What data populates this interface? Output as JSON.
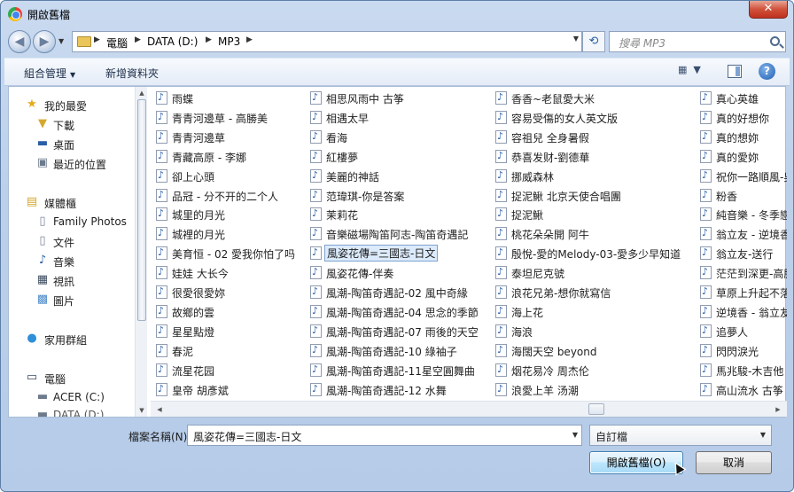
{
  "window": {
    "title": "開啟舊檔",
    "close_label": "✕"
  },
  "nav": {
    "breadcrumbs": [
      "電腦",
      "DATA (D:)",
      "MP3"
    ],
    "search_placeholder": "搜尋 MP3"
  },
  "toolbar": {
    "organize": "組合管理",
    "new_folder": "新增資料夾"
  },
  "sidebar": {
    "items": [
      {
        "label": "我的最愛",
        "icon": "star-icon"
      },
      {
        "label": "下載",
        "icon": "download-folder-icon"
      },
      {
        "label": "桌面",
        "icon": "desktop-icon"
      },
      {
        "label": "最近的位置",
        "icon": "recent-places-icon"
      },
      {
        "label": "媒體櫃",
        "icon": "library-icon"
      },
      {
        "label": "Family Photos",
        "icon": "document-icon"
      },
      {
        "label": "文件",
        "icon": "document-icon"
      },
      {
        "label": "音樂",
        "icon": "music-icon"
      },
      {
        "label": "視訊",
        "icon": "video-icon"
      },
      {
        "label": "圖片",
        "icon": "pictures-icon"
      },
      {
        "label": "家用群組",
        "icon": "homegroup-icon"
      },
      {
        "label": "電腦",
        "icon": "computer-icon"
      },
      {
        "label": "ACER (C:)",
        "icon": "drive-icon"
      },
      {
        "label": "DATA (D:)",
        "icon": "drive-icon"
      }
    ]
  },
  "files": {
    "col1": [
      "雨蝶",
      "青青河邊草 - 高勝美",
      "青青河邊草",
      "青藏高原 - 李娜",
      "卻上心頭",
      "品冠 - 分不开的二个人",
      "城里的月光",
      "城裡的月光",
      "美育恒 - 02 愛我你怕了吗",
      "娃娃 大长今",
      "很愛很愛妳",
      "故鄉的雲",
      "星星點燈",
      "春泥",
      "流星花园",
      "皇帝 胡彥斌"
    ],
    "col2": [
      "相思风雨中 古筝",
      "相遇太早",
      "看海",
      "紅樓夢",
      "美麗的神話",
      "范瑋琪-你是答案",
      "茉莉花",
      "音樂磁場陶笛阿志-陶笛奇遇記",
      "風姿花傳=三國志-日文",
      "風姿花傳-伴奏",
      "風潮-陶笛奇遇記-02 風中奇緣",
      "風潮-陶笛奇遇記-04 思念的季節",
      "風潮-陶笛奇遇記-07 雨後的天空",
      "風潮-陶笛奇遇記-10 綠袖子",
      "風潮-陶笛奇遇記-11星空圓舞曲",
      "風潮-陶笛奇遇記-12 水舞"
    ],
    "col3": [
      "香香~老鼠愛大米",
      "容易受傷的女人英文版",
      "容祖兒 全身暑假",
      "恭喜发财-劉德華",
      "挪威森林",
      "捉泥鰍 北京天使合唱團",
      "捉泥鰍",
      "桃花朵朵開 阿牛",
      "殷悅-愛的Melody-03-愛多少早知道",
      "泰坦尼克號",
      "浪花兄弟-想你就寫信",
      "海上花",
      "海浪",
      "海闊天空 beyond",
      "烟花易冷 周杰伦",
      "浪愛上羊 汤潮"
    ],
    "col4": [
      "真心英雄",
      "真的好想你",
      "真的想妳",
      "真的愛妳",
      "祝你一路順風-吳",
      "粉香",
      "純音樂 - 冬季戀",
      "翁立友 - 逆境香",
      "翁立友-送行",
      "茫茫到深更-高勝",
      "草原上升起不落",
      "逆境香 - 翁立友",
      "追夢人",
      "閃閃淚光",
      "馬兆駿-木吉他 -",
      "高山流水 古筝"
    ],
    "selected": "風姿花傳=三國志-日文"
  },
  "bottom": {
    "filename_label": "檔案名稱(N):",
    "filename_value": "風姿花傳=三國志-日文",
    "filter_value": "自訂檔",
    "open_label": "開啟舊檔(O)",
    "cancel_label": "取消"
  }
}
